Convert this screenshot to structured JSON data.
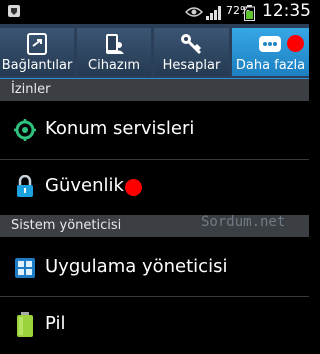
{
  "status_bar": {
    "battery_percent": "72%",
    "time": "12:35",
    "icons": [
      "notification-icon",
      "eye-icon",
      "signal-icon",
      "battery-icon"
    ]
  },
  "tabs": [
    {
      "label": "Bağlantılar",
      "icon": "connections-icon",
      "selected": false
    },
    {
      "label": "Cihazım",
      "icon": "device-icon",
      "selected": false
    },
    {
      "label": "Hesaplar",
      "icon": "key-icon",
      "selected": false
    },
    {
      "label": "Daha fazla",
      "icon": "more-icon",
      "selected": true
    }
  ],
  "sections": [
    {
      "title": "İzinler",
      "items": [
        {
          "label": "Konum servisleri",
          "icon": "location-icon"
        },
        {
          "label": "Güvenlik",
          "icon": "lock-icon",
          "badge": "red-dot"
        }
      ]
    },
    {
      "title": "Sistem yöneticisi",
      "items": [
        {
          "label": "Uygulama yöneticisi",
          "icon": "apps-grid-icon"
        },
        {
          "label": "Pil",
          "icon": "battery-green-icon"
        }
      ]
    }
  ],
  "watermark": "Sordum.net",
  "colors": {
    "accent": "#2d90d2",
    "tab_bg": "#2b3f58",
    "section_bg": "#3b3f44",
    "badge": "#ff0000"
  }
}
